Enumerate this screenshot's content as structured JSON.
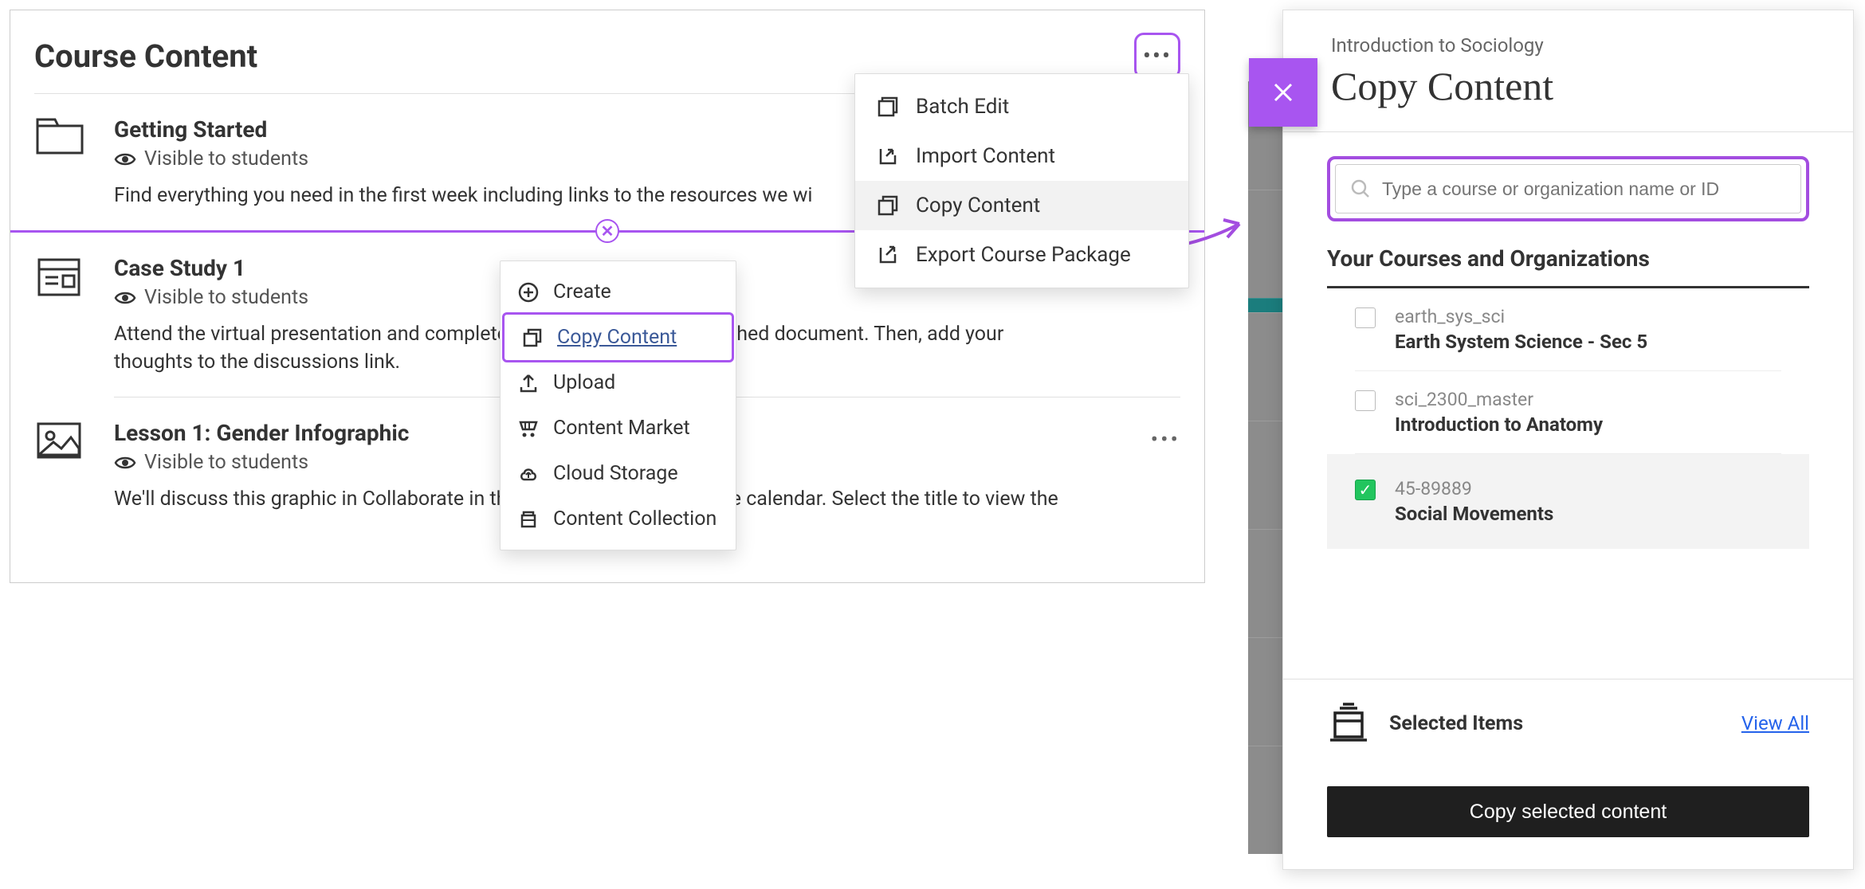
{
  "left": {
    "title": "Course Content",
    "items": [
      {
        "title": "Getting Started",
        "visibility": "Visible to students",
        "desc": "Find everything you need in the first week including links to the resources we wi"
      },
      {
        "title": "Case Study 1",
        "visibility": "Visible to students",
        "desc": "Attend the virtual presentation and complete the questions in the attached document. Then, add your thoughts to the discussions link."
      },
      {
        "title": "Lesson 1: Gender Infographic",
        "visibility": "Visible to students",
        "desc": "We'll discuss this graphic in Collaborate in the session scheduled in the calendar. Select the title to view the"
      }
    ]
  },
  "overflow_menu": {
    "items": [
      "Batch Edit",
      "Import Content",
      "Copy Content",
      "Export Course Package"
    ]
  },
  "context_menu": {
    "items": [
      "Create",
      "Copy Content",
      "Upload",
      "Content Market",
      "Cloud Storage",
      "Content Collection"
    ]
  },
  "right": {
    "subtitle": "Introduction to Sociology",
    "title": "Copy Content",
    "search_placeholder": "Type a course or organization name or ID",
    "section": "Your Courses and Organizations",
    "courses": [
      {
        "code": "earth_sys_sci",
        "name": "Earth System Science - Sec 5",
        "checked": false
      },
      {
        "code": "sci_2300_master",
        "name": "Introduction to Anatomy",
        "checked": false
      },
      {
        "code": "45-89889",
        "name": "Social Movements",
        "checked": true
      }
    ],
    "selected_label": "Selected Items",
    "view_all": "View All",
    "action": "Copy selected content"
  }
}
